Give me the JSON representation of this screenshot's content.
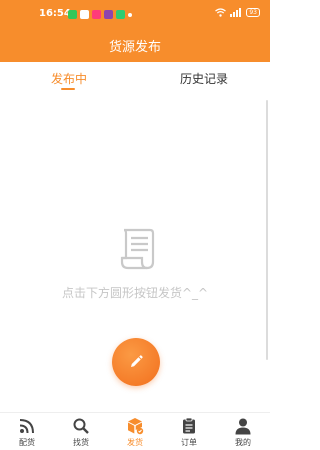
{
  "status_bar": {
    "time": "16:54",
    "battery": "93"
  },
  "header": {
    "title": "货源发布"
  },
  "tabs": [
    {
      "label": "发布中",
      "active": true
    },
    {
      "label": "历史记录",
      "active": false
    }
  ],
  "empty_state": {
    "message": "点击下方圆形按钮发货^_^",
    "icon": "document-icon"
  },
  "fab": {
    "icon": "pencil-icon"
  },
  "bottom_nav": [
    {
      "label": "配货",
      "icon": "rss-icon",
      "active": false
    },
    {
      "label": "找货",
      "icon": "search-icon",
      "active": false
    },
    {
      "label": "发货",
      "icon": "box-icon",
      "active": true
    },
    {
      "label": "订单",
      "icon": "clipboard-icon",
      "active": false
    },
    {
      "label": "我的",
      "icon": "user-icon",
      "active": false
    }
  ],
  "colors": {
    "accent": "#f78d2c",
    "text_muted": "#c6c6c6"
  }
}
